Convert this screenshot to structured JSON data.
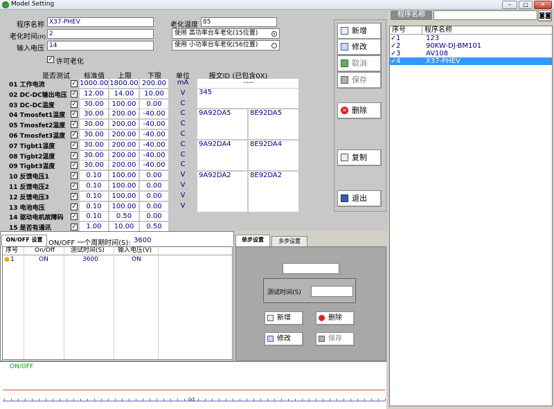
{
  "window": {
    "title": "Model Setting",
    "min": "–",
    "max": "□",
    "close": "✕"
  },
  "form": {
    "program_name_label": "程序名称",
    "program_name_value": "X37-PHEV",
    "aging_time_label": "老化时间",
    "aging_time_unit": "(H)",
    "aging_time_value": "2",
    "input_voltage_label": "输入电压",
    "input_voltage_value": "14",
    "aging_temp_label": "老化温度",
    "aging_temp_value": "85",
    "opt_high": "使用  高功率台车老化(15位置)",
    "opt_low": "使用  小功率台车老化(56位置)",
    "allow_label": "许可老化"
  },
  "table": {
    "headers": {
      "test": "是否测试",
      "std": "标准值",
      "upper": "上限",
      "lower": "下限",
      "unit": "单位",
      "report": "报文ID (已包含0X)"
    },
    "rows": [
      {
        "name": "01 工作电流",
        "std": "1000.00",
        "upper": "1800.00",
        "lower": "200.00",
        "unit": "mA"
      },
      {
        "name": "02 DC-DC输出电压",
        "std": "12.00",
        "upper": "14.00",
        "lower": "10.00",
        "unit": "V"
      },
      {
        "name": "03 DC-DC温度",
        "std": "30.00",
        "upper": "100.00",
        "lower": "0.00",
        "unit": "C"
      },
      {
        "name": "04 Tmosfet1温度",
        "std": "30.00",
        "upper": "200.00",
        "lower": "-40.00",
        "unit": "C"
      },
      {
        "name": "05 Tmosfet2温度",
        "std": "30.00",
        "upper": "200.00",
        "lower": "-40.00",
        "unit": "C"
      },
      {
        "name": "06 Tmosfet3温度",
        "std": "30.00",
        "upper": "200.00",
        "lower": "-40.00",
        "unit": "C"
      },
      {
        "name": "07 Tigbt1温度",
        "std": "30.00",
        "upper": "200.00",
        "lower": "-40.00",
        "unit": "C"
      },
      {
        "name": "08 Tigbt2温度",
        "std": "30.00",
        "upper": "200.00",
        "lower": "-40.00",
        "unit": "C"
      },
      {
        "name": "09 Tigbt3温度",
        "std": "30.00",
        "upper": "200.00",
        "lower": "-40.00",
        "unit": "C"
      },
      {
        "name": "10 反馈电压1",
        "std": "0.10",
        "upper": "100.00",
        "lower": "0.00",
        "unit": "V"
      },
      {
        "name": "11 反馈电压2",
        "std": "0.10",
        "upper": "100.00",
        "lower": "0.00",
        "unit": "V"
      },
      {
        "name": "12 反馈电压3",
        "std": "0.10",
        "upper": "100.00",
        "lower": "0.00",
        "unit": "V"
      },
      {
        "name": "13 电池电压",
        "std": "0.10",
        "upper": "100.00",
        "lower": "0.00",
        "unit": "V"
      },
      {
        "name": "14 驱动电机故障码",
        "std": "0.10",
        "upper": "0.50",
        "lower": "0.00",
        "unit": ""
      },
      {
        "name": "15 是否有通讯",
        "std": "1.00",
        "upper": "10.00",
        "lower": "0.50",
        "unit": ""
      }
    ],
    "report": {
      "r1": "----",
      "r2": "345",
      "r4a": "9A92DA5",
      "r4b": "8E92DA5",
      "r7a": "9A92DA4",
      "r7b": "8E92DA4",
      "r10a": "9A92DA2",
      "r10b": "8E92DA2"
    }
  },
  "buttons": {
    "add": "新增",
    "edit": "修改",
    "cancel": "取消",
    "save": "保存",
    "delete": "删除",
    "copy": "复制",
    "exit": "退出"
  },
  "programs": {
    "header_label": "程序名称",
    "col_no": "序号",
    "col_name": "程序名称",
    "items": [
      {
        "no": "1",
        "name": "123"
      },
      {
        "no": "2",
        "name": "90KW-DJ-BM101"
      },
      {
        "no": "3",
        "name": "AV108"
      },
      {
        "no": "4",
        "name": "X37-PHEV"
      }
    ]
  },
  "onoff": {
    "tab": "ON/OFF 设置",
    "period_label": "ON/OFF 一个周期时间(S):",
    "period_value": "3600",
    "cols": {
      "no": "序号",
      "onoff": "On/Off",
      "time": "测试时间(S)",
      "voltage": "输入电压(V)"
    },
    "row": {
      "no": "1",
      "onoff": "ON",
      "time": "3600",
      "voltage": "ON"
    }
  },
  "step": {
    "tab_single": "单步设置",
    "tab_multi": "多步设置",
    "test_time_label": "测试时间(S)",
    "add": "新增",
    "delete": "删除",
    "edit": "修改",
    "save": "保存"
  },
  "plot": {
    "series_label": "ON/OFF",
    "tick_label": "0.5"
  },
  "colors": {
    "selection": "#3399ff",
    "value_text": "#000080",
    "plot_line": "#ff3333",
    "plot_label": "#00aa00"
  }
}
